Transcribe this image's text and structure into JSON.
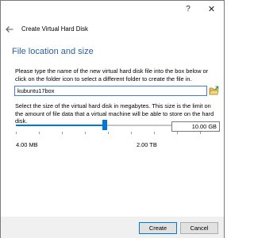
{
  "titlebar": {
    "help_label": "?",
    "close_label": "✕"
  },
  "wizard": {
    "heading": "Create Virtual Hard Disk",
    "section_title": "File location and size",
    "location_text": "Please type the name of the new virtual hard disk file into the box below or click on the folder icon to select a different folder to create the file in.",
    "file_name": "kubuntu17box",
    "size_text": "Select the size of the virtual hard disk in megabytes. This size is the limit on the amount of file data that a virtual machine will be able to store on the hard disk.",
    "size_value": "10.00 GB",
    "slider_level": 0.48,
    "min_label": "4.00 MB",
    "max_label": "2.00 TB"
  },
  "buttons": {
    "create_label": "Create",
    "cancel_label": "Cancel"
  },
  "icons": {
    "back": "back-arrow-icon",
    "folder": "folder-open-icon"
  },
  "colors": {
    "accent": "#0078d7",
    "section_title": "#2c5fa3"
  }
}
